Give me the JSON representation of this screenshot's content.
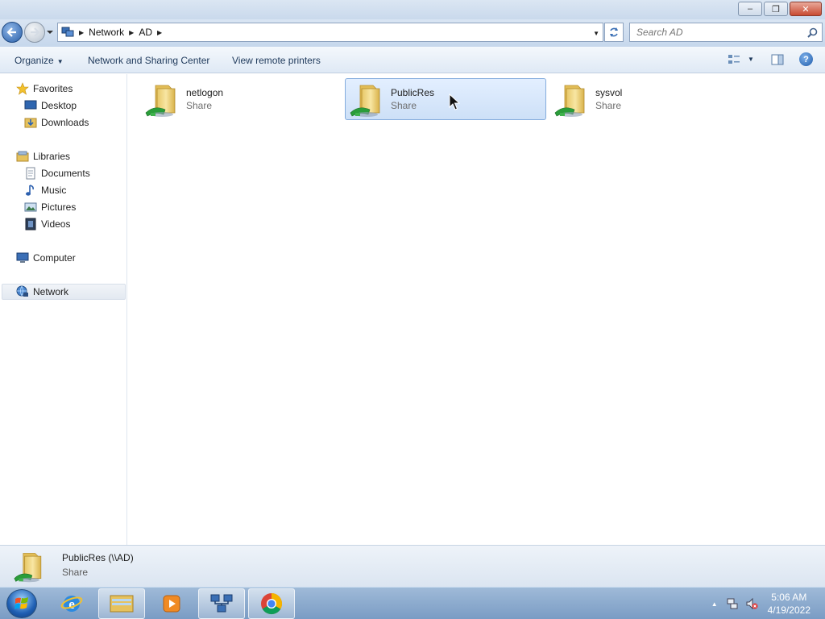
{
  "window": {
    "minimize_glyph": "–",
    "restore_glyph": "❐",
    "close_glyph": "✕"
  },
  "address_bar": {
    "crumbs": [
      "Network",
      "AD"
    ],
    "search_placeholder": "Search AD"
  },
  "command_bar": {
    "organize": "Organize",
    "network_sharing": "Network and Sharing Center",
    "remote_printers": "View remote printers",
    "help_glyph": "?"
  },
  "nav_pane": {
    "favorites": {
      "label": "Favorites",
      "items": [
        "Desktop",
        "Downloads"
      ]
    },
    "libraries": {
      "label": "Libraries",
      "items": [
        "Documents",
        "Music",
        "Pictures",
        "Videos"
      ]
    },
    "computer": "Computer",
    "network": "Network"
  },
  "shares": [
    {
      "name": "netlogon",
      "type": "Share",
      "selected": false
    },
    {
      "name": "PublicRes",
      "type": "Share",
      "selected": true
    },
    {
      "name": "sysvol",
      "type": "Share",
      "selected": false
    }
  ],
  "details_pane": {
    "name": "PublicRes (\\\\AD)",
    "type": "Share"
  },
  "taskbar": {
    "time": "5:06 AM",
    "date": "4/19/2022",
    "pinned": [
      "internet-explorer",
      "windows-explorer",
      "media-player",
      "network-app",
      "chrome"
    ]
  },
  "colors": {
    "selection_fill": "#cde0f7",
    "selection_border": "#84acdd",
    "taskbar": "#7a9cc4"
  }
}
